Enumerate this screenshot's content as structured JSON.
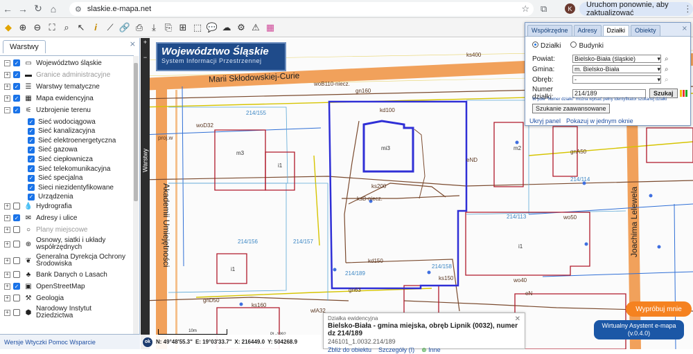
{
  "browser": {
    "url": "slaskie.e-mapa.net",
    "avatar_letter": "K",
    "update_label": "Uruchom ponownie, aby zaktualizować",
    "icons": [
      "back-arrow-icon",
      "forward-arrow-icon",
      "reload-icon",
      "home-icon",
      "site-info-icon",
      "star-icon",
      "extensions-icon",
      "menu-dots-icon"
    ]
  },
  "banner": {
    "title": "Województwo Śląskie",
    "subtitle": "System Informacji Przestrzennej"
  },
  "layers_panel": {
    "tab_label": "Warstwy",
    "items": [
      {
        "label": "Województwo śląskie",
        "checked": true,
        "expand": "−",
        "icon": "▭",
        "muted": false
      },
      {
        "label": "Granice administracyjne",
        "checked": true,
        "expand": "+",
        "icon": "▬",
        "muted": true
      },
      {
        "label": "Warstwy tematyczne",
        "checked": true,
        "expand": "+",
        "icon": "☰",
        "muted": false
      },
      {
        "label": "Mapa ewidencyjna",
        "checked": true,
        "expand": "+",
        "icon": "▦",
        "muted": false
      },
      {
        "label": "Uzbrojenie terenu",
        "checked": true,
        "expand": "−",
        "icon": "⚟",
        "muted": false
      },
      {
        "label": "Sieć wodociągowa",
        "checked": true,
        "sub": true
      },
      {
        "label": "Sieć kanalizacyjna",
        "checked": true,
        "sub": true
      },
      {
        "label": "Sieć elektroenergetyczna",
        "checked": true,
        "sub": true
      },
      {
        "label": "Sieć gazowa",
        "checked": true,
        "sub": true
      },
      {
        "label": "Sieć ciepłownicza",
        "checked": true,
        "sub": true
      },
      {
        "label": "Sieć telekomunikacyjna",
        "checked": true,
        "sub": true
      },
      {
        "label": "Sieć specjalna",
        "checked": true,
        "sub": true
      },
      {
        "label": "Sieci niezidentyfikowane",
        "checked": true,
        "sub": true
      },
      {
        "label": "Urządzenia",
        "checked": true,
        "sub": true
      },
      {
        "label": "Hydrografia",
        "checked": false,
        "expand": "+",
        "icon": "💧",
        "muted": false
      },
      {
        "label": "Adresy i ulice",
        "checked": true,
        "expand": "+",
        "icon": "✉",
        "muted": false
      },
      {
        "label": "Plany miejscowe",
        "checked": false,
        "expand": "+",
        "icon": "○",
        "muted": true
      },
      {
        "label": "Osnowy, siatki i układy współrzędnych",
        "checked": false,
        "expand": "+",
        "icon": "⊕",
        "muted": false
      },
      {
        "label": "Generalna Dyrekcja Ochrony Środowiska",
        "checked": false,
        "expand": "+",
        "icon": "❦",
        "muted": false
      },
      {
        "label": "Bank Danych o Lasach",
        "checked": false,
        "expand": "+",
        "icon": "♣",
        "muted": false
      },
      {
        "label": "OpenStreetMap",
        "checked": true,
        "expand": "+",
        "icon": "▣",
        "muted": false
      },
      {
        "label": "Geologia",
        "checked": false,
        "expand": "+",
        "icon": "⚒",
        "muted": false
      },
      {
        "label": "Narodowy Instytut Dziedzictwa",
        "checked": false,
        "expand": "+",
        "icon": "⬢",
        "muted": false
      }
    ],
    "footer": "Wersje   Wtyczki   Pomoc   Wsparcie"
  },
  "map": {
    "streets": {
      "curie": "Marii Skłodowskiej-Curie",
      "akademii": "Akademii Umiejętności",
      "lelewela": "Joachima Lelewela"
    },
    "parcel_labels": [
      "214/155",
      "214/156",
      "214/157",
      "214/158",
      "214/189",
      "214/114",
      "214/113"
    ],
    "building_labels": [
      "mi3",
      "m3",
      "i1",
      "m2",
      "i1",
      "i1"
    ],
    "network_labels": [
      "ks400",
      "ks160",
      "ks200",
      "kd150",
      "ks150",
      "kd100",
      "woD32",
      "woB110-niecz.",
      "ksB-niecz.",
      "gn160",
      "gn63",
      "eND",
      "gnA50",
      "wo50",
      "wo40",
      "eN",
      "gnD50",
      "wlA32",
      "proj.w"
    ]
  },
  "search_panel": {
    "tabs": [
      "Współrzędne",
      "Adresy",
      "Działki",
      "Obiekty"
    ],
    "active_tab": "Działki",
    "radio_parcels": "Działki",
    "radio_buildings": "Budynki",
    "powiat_label": "Powiat:",
    "powiat_value": "Bielsko-Biała (śląskie)",
    "gmina_label": "Gmina:",
    "gmina_value": "m. Bielsko-Biała",
    "obreb_label": "Obręb:",
    "obreb_value": "-",
    "parcel_number_label": "Numer działki:",
    "parcel_number_value": "214/189",
    "search_button": "Szukaj",
    "hint": "W pole \"Numer działki\" można wpisać pełny identyfikator szukanej działki",
    "advanced_button": "Szukanie zaawansowane",
    "hide_panel": "Ukryj panel",
    "show_one_window": "Pokazuj w jednym oknie"
  },
  "info_popup": {
    "header": "Działka ewidencyjna",
    "main": "Bielsko-Biała - gmina miejska, obręb Lipnik (0032), numer dz 214/189",
    "identifier": "246101_1.0032.214/189",
    "links": [
      "Zbliż do obiektu",
      "Szczegóły (I)",
      "Inne"
    ]
  },
  "status": {
    "ok": "ok",
    "lat": "N: 49°48'55.3\"",
    "lon": "E: 19°03'33.7\"",
    "x": "X: 216449.0",
    "y": "Y: 504268.9",
    "crs": "PL-1992",
    "scale": "10m"
  },
  "buttons": {
    "try": "Wypróbuj mnie",
    "assistant_line1": "Wirtualny Asystent e-mapa",
    "assistant_line2": "(v.0.4.0)"
  },
  "colors": {
    "parcel_blue": "#2f2fd6",
    "road_orange": "#f1a15b",
    "building_red": "#b0182a",
    "sewer_brown": "#7a4a2e",
    "gas_yellow": "#d6c400",
    "water_blue": "#2f6fd6",
    "accent_orange": "#f58220",
    "accent_blue": "#1b57a6"
  }
}
